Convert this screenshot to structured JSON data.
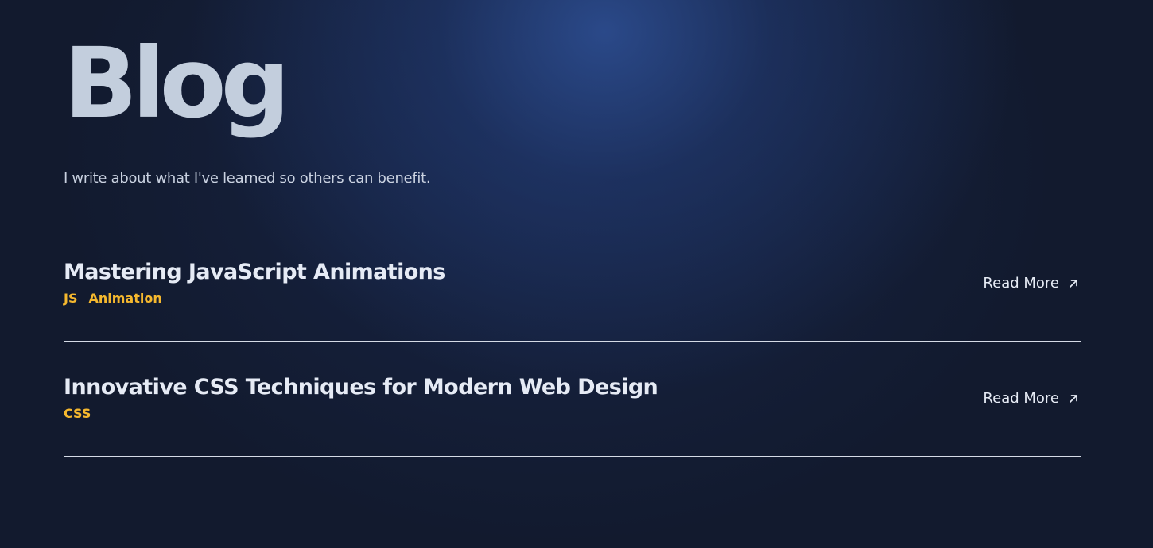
{
  "header": {
    "title": "Blog",
    "subtitle": "I write about what I've learned so others can benefit."
  },
  "posts": [
    {
      "title": "Mastering JavaScript Animations",
      "tags": [
        "JS",
        "Animation"
      ],
      "read_more_label": "Read More",
      "read_more_icon": "arrow-up-right-icon"
    },
    {
      "title": "Innovative CSS Techniques for Modern Web Design",
      "tags": [
        "CSS"
      ],
      "read_more_label": "Read More",
      "read_more_icon": "arrow-up-right-icon"
    }
  ],
  "colors": {
    "background": "#121a2e",
    "glow": "#2e5096",
    "title": "#c3cedd",
    "text": "#e6ebf5",
    "tag": "#f5b82e",
    "divider": "#d5dbe6"
  }
}
